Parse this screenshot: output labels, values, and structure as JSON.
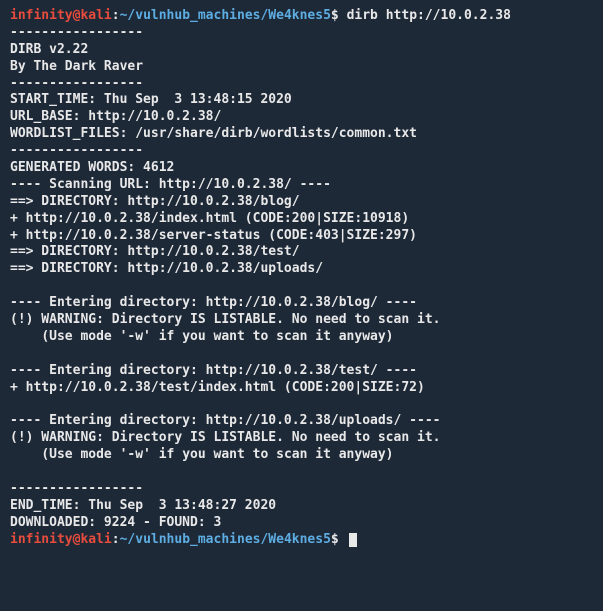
{
  "prompt1": {
    "user": "infinity",
    "at": "@",
    "host": "kali",
    "colon": ":",
    "path": "~/vulnhub_machines/We4knes5",
    "dollar": "$",
    "command": "dirb http://10.0.2.38"
  },
  "output": {
    "blank1": "",
    "sep1": "-----------------",
    "dirb_version": "DIRB v2.22    ",
    "by": "By The Dark Raver",
    "sep2": "-----------------",
    "blank2": "",
    "start_time": "START_TIME: Thu Sep  3 13:48:15 2020",
    "url_base": "URL_BASE: http://10.0.2.38/",
    "wordlist": "WORDLIST_FILES: /usr/share/dirb/wordlists/common.txt",
    "blank3": "",
    "sep3": "-----------------",
    "blank4": "",
    "generated": "GENERATED WORDS: 4612                                                          ",
    "blank5": "",
    "scanning": "---- Scanning URL: http://10.0.2.38/ ----",
    "dir_blog": "==> DIRECTORY: http://10.0.2.38/blog/                                          ",
    "index_html": "+ http://10.0.2.38/index.html (CODE:200|SIZE:10918)                            ",
    "server_status": "+ http://10.0.2.38/server-status (CODE:403|SIZE:297)                           ",
    "dir_test": "==> DIRECTORY: http://10.0.2.38/test/                                          ",
    "dir_uploads": "==> DIRECTORY: http://10.0.2.38/uploads/                                       ",
    "blank6": "                                                                               ",
    "entering_blog": "---- Entering directory: http://10.0.2.38/blog/ ----",
    "warn_blog": "(!) WARNING: Directory IS LISTABLE. No need to scan it.                        ",
    "mode_w1": "    (Use mode '-w' if you want to scan it anyway)",
    "blank7": "                                                                               ",
    "entering_test": "---- Entering directory: http://10.0.2.38/test/ ----",
    "test_index": "+ http://10.0.2.38/test/index.html (CODE:200|SIZE:72)                          ",
    "blank8": "                                                                               ",
    "entering_uploads": "---- Entering directory: http://10.0.2.38/uploads/ ----",
    "warn_uploads": "(!) WARNING: Directory IS LISTABLE. No need to scan it.                        ",
    "mode_w2": "    (Use mode '-w' if you want to scan it anyway)",
    "blank9": "                                                                               ",
    "sep4": "-----------------",
    "end_time": "END_TIME: Thu Sep  3 13:48:27 2020",
    "downloaded": "DOWNLOADED: 9224 - FOUND: 3"
  },
  "prompt2": {
    "user": "infinity",
    "at": "@",
    "host": "kali",
    "colon": ":",
    "path": "~/vulnhub_machines/We4knes5",
    "dollar": "$"
  }
}
